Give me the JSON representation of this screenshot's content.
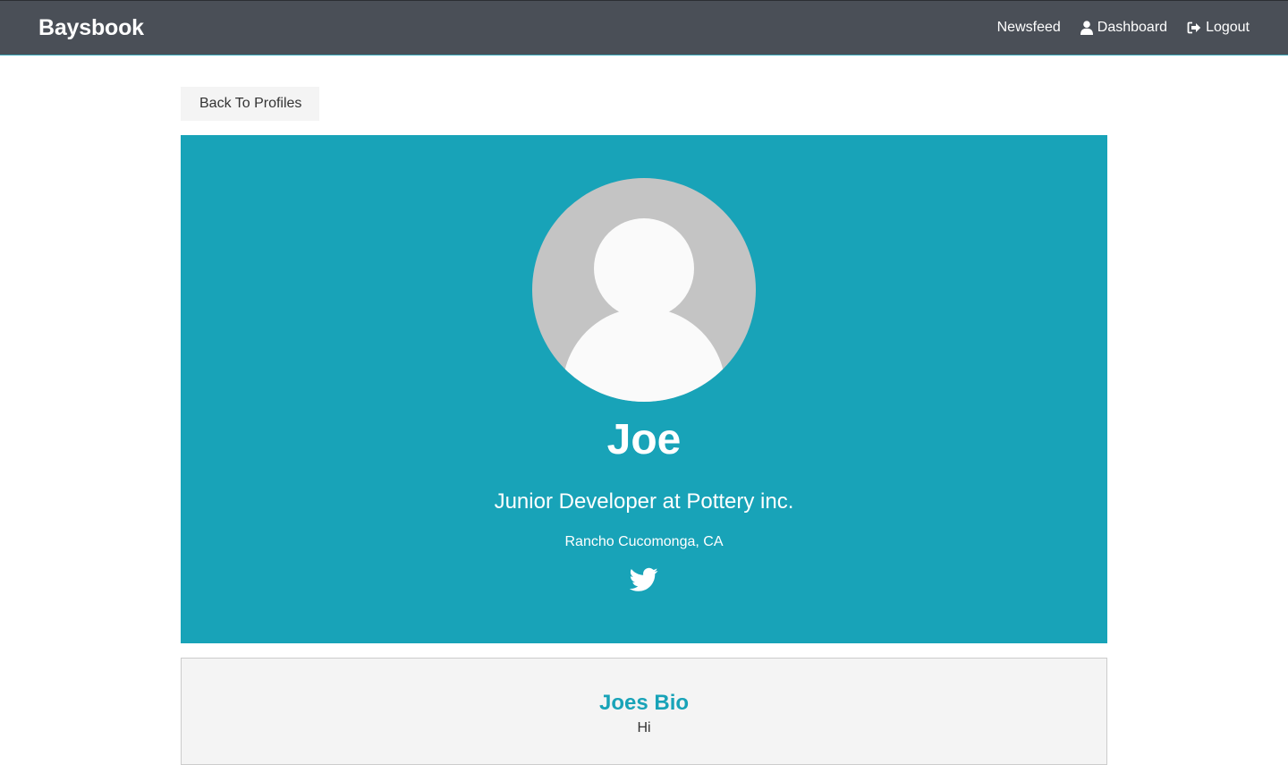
{
  "navbar": {
    "brand": "Baysbook",
    "links": [
      {
        "label": "Newsfeed",
        "icon": ""
      },
      {
        "label": "Dashboard",
        "icon": "user-icon"
      },
      {
        "label": "Logout",
        "icon": "sign-out-icon"
      }
    ]
  },
  "back_button": {
    "label": "Back To Profiles"
  },
  "profile": {
    "name": "Joe",
    "title": "Junior Developer at Pottery inc.",
    "location": "Rancho Cucomonga, CA",
    "social_icon": "twitter-icon",
    "avatar_icon": "default-avatar-icon"
  },
  "bio": {
    "title": "Joes Bio",
    "text": "Hi"
  },
  "colors": {
    "navbar_bg": "#4a4f57",
    "accent": "#18a3b8",
    "card_bg": "#f4f4f4"
  }
}
